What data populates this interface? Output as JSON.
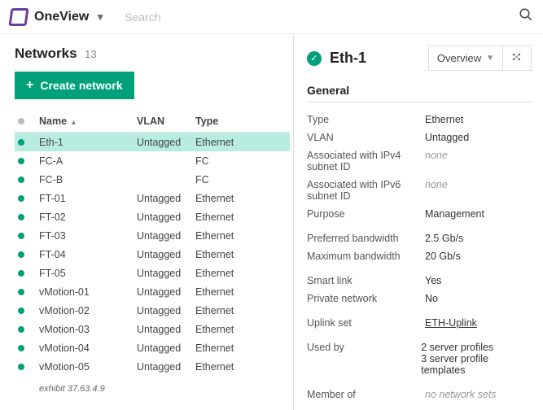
{
  "topbar": {
    "brand": "OneView",
    "searchPlaceholder": "Search"
  },
  "left": {
    "title": "Networks",
    "count": "13",
    "createLabel": "Create network",
    "columns": {
      "name": "Name",
      "vlan": "VLAN",
      "type": "Type"
    },
    "rows": [
      {
        "name": "Eth-1",
        "vlan": "Untagged",
        "type": "Ethernet",
        "selected": true
      },
      {
        "name": "FC-A",
        "vlan": "",
        "type": "FC"
      },
      {
        "name": "FC-B",
        "vlan": "",
        "type": "FC"
      },
      {
        "name": "FT-01",
        "vlan": "Untagged",
        "type": "Ethernet"
      },
      {
        "name": "FT-02",
        "vlan": "Untagged",
        "type": "Ethernet"
      },
      {
        "name": "FT-03",
        "vlan": "Untagged",
        "type": "Ethernet"
      },
      {
        "name": "FT-04",
        "vlan": "Untagged",
        "type": "Ethernet"
      },
      {
        "name": "FT-05",
        "vlan": "Untagged",
        "type": "Ethernet"
      },
      {
        "name": "vMotion-01",
        "vlan": "Untagged",
        "type": "Ethernet"
      },
      {
        "name": "vMotion-02",
        "vlan": "Untagged",
        "type": "Ethernet"
      },
      {
        "name": "vMotion-03",
        "vlan": "Untagged",
        "type": "Ethernet"
      },
      {
        "name": "vMotion-04",
        "vlan": "Untagged",
        "type": "Ethernet"
      },
      {
        "name": "vMotion-05",
        "vlan": "Untagged",
        "type": "Ethernet"
      }
    ],
    "exhibit": "exhibit 37.63.4.9"
  },
  "detail": {
    "title": "Eth-1",
    "view": "Overview",
    "sectionGeneral": "General",
    "props": {
      "type_k": "Type",
      "type_v": "Ethernet",
      "vlan_k": "VLAN",
      "vlan_v": "Untagged",
      "ipv4_k": "Associated with IPv4 subnet ID",
      "ipv4_v": "none",
      "ipv6_k": "Associated with IPv6 subnet ID",
      "ipv6_v": "none",
      "purpose_k": "Purpose",
      "purpose_v": "Management",
      "prefbw_k": "Preferred bandwidth",
      "prefbw_v": "2.5 Gb/s",
      "maxbw_k": "Maximum bandwidth",
      "maxbw_v": "20 Gb/s",
      "smart_k": "Smart link",
      "smart_v": "Yes",
      "priv_k": "Private network",
      "priv_v": "No",
      "uplink_k": "Uplink set",
      "uplink_v": "ETH-Uplink",
      "usedby_k": "Used by",
      "usedby_v1": "2 server profiles",
      "usedby_v2": "3 server profile templates",
      "member_k": "Member of",
      "member_v": "no network sets"
    }
  }
}
